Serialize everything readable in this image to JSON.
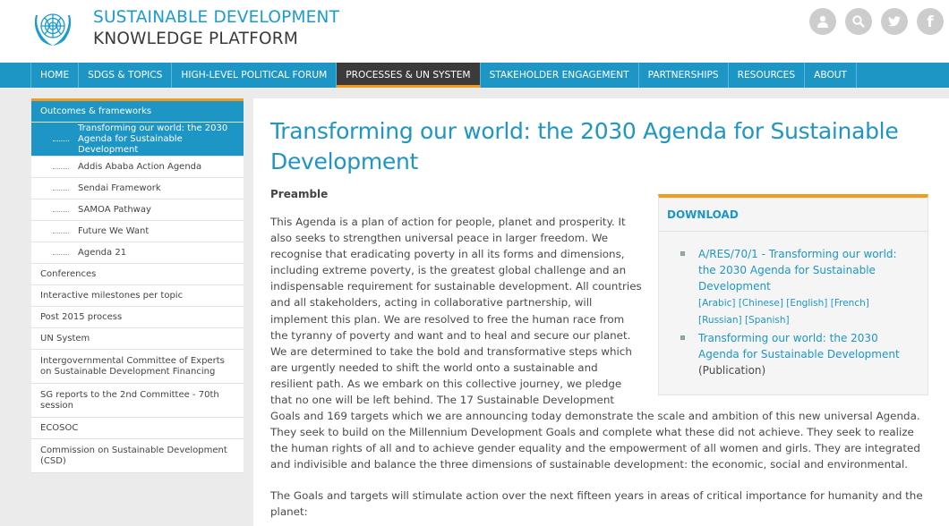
{
  "header": {
    "title_line1": "SUSTAINABLE DEVELOPMENT",
    "title_line2": "KNOWLEDGE PLATFORM",
    "icons": [
      "user-icon",
      "search-icon",
      "twitter-icon",
      "facebook-icon"
    ],
    "facebook_glyph": "f"
  },
  "nav": {
    "items": [
      "HOME",
      "SDGS & TOPICS",
      "HIGH-LEVEL POLITICAL FORUM",
      "PROCESSES & UN SYSTEM",
      "STAKEHOLDER ENGAGEMENT",
      "PARTNERSHIPS",
      "RESOURCES",
      "ABOUT"
    ],
    "active": "PROCESSES & UN SYSTEM"
  },
  "sidebar": {
    "heading": "Outcomes & frameworks",
    "sub_items": [
      "Transforming our world: the 2030 Agenda for Sustainable Development",
      "Addis Ababa Action Agenda",
      "Sendai Framework",
      "SAMOA Pathway",
      "Future We Want",
      "Agenda 21"
    ],
    "items": [
      "Conferences",
      "Interactive milestones per topic",
      "Post 2015 process",
      "UN System",
      "Intergovernmental Committee of Experts on Sustainable Development Financing",
      "SG reports to the 2nd Committee - 70th session",
      "ECOSOC",
      "Commission on Sustainable Development (CSD)"
    ]
  },
  "main": {
    "title": "Transforming our world: the 2030 Agenda for Sustainable Development",
    "section_heading": "Preamble",
    "paragraph1": "This Agenda is a plan of action for people, planet and prosperity. It also seeks to strengthen universal peace in larger freedom. We recognise that eradicating poverty in all its forms and dimensions, including extreme poverty, is the greatest global challenge and an indispensable requirement for sustainable development. All countries and all stakeholders, acting in collaborative partnership, will implement this plan. We are resolved to free the human race from the tyranny of poverty and want and to heal and secure our planet. We are determined to take the bold and transformative steps which are urgently needed to shift the world onto a sustainable and resilient path. As we embark on this collective journey, we pledge that no one will be left behind. The 17 Sustainable Development Goals and 169 targets which we are announcing today demonstrate the scale and ambition of this new universal Agenda. They seek to build on the Millennium Development Goals and complete what these did not achieve. They seek to realize the human rights of all and to achieve gender equality and the empowerment of all women and girls. They are integrated and indivisible and balance the three dimensions of sustainable development: the economic, social and environmental.",
    "paragraph2": "The Goals and targets will stimulate action over the next fifteen years in areas of critical importance for humanity and the planet:"
  },
  "download": {
    "heading": "DOWNLOAD",
    "item1_link": "A/RES/70/1 - Transforming our world: the 2030 Agenda for Sustainable Development",
    "item1_langs": "[Arabic] [Chinese] [English] [French] [Russian] [Spanish]",
    "item2_link": "Transforming our world: the 2030 Agenda for Sustainable Development",
    "item2_note": "(Publication)"
  }
}
